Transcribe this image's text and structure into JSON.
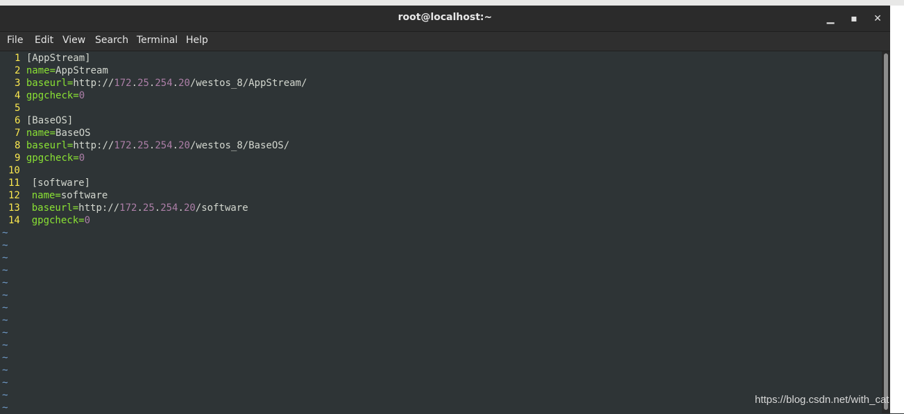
{
  "window": {
    "title": "root@localhost:~",
    "minimize_glyph": "▁",
    "maximize_glyph": "▪",
    "close_glyph": "✕"
  },
  "menu": [
    "File",
    "Edit",
    "View",
    "Search",
    "Terminal",
    "Help"
  ],
  "editor": {
    "lines": [
      {
        "n": "1",
        "parts": [
          {
            "t": "[AppStream]",
            "c": "txt"
          }
        ]
      },
      {
        "n": "2",
        "parts": [
          {
            "t": "name=",
            "c": "kw"
          },
          {
            "t": "AppStream",
            "c": "txt"
          }
        ]
      },
      {
        "n": "3",
        "parts": [
          {
            "t": "baseurl=",
            "c": "kw"
          },
          {
            "t": "http://",
            "c": "txt"
          },
          {
            "t": "172",
            "c": "num"
          },
          {
            "t": ".",
            "c": "txt"
          },
          {
            "t": "25",
            "c": "num"
          },
          {
            "t": ".",
            "c": "txt"
          },
          {
            "t": "254",
            "c": "num"
          },
          {
            "t": ".",
            "c": "txt"
          },
          {
            "t": "20",
            "c": "num"
          },
          {
            "t": "/westos_8/AppStream/",
            "c": "txt"
          }
        ]
      },
      {
        "n": "4",
        "parts": [
          {
            "t": "gpgcheck=",
            "c": "kw"
          },
          {
            "t": "0",
            "c": "num"
          }
        ]
      },
      {
        "n": "5",
        "parts": []
      },
      {
        "n": "6",
        "parts": [
          {
            "t": "[BaseOS]",
            "c": "txt"
          }
        ]
      },
      {
        "n": "7",
        "parts": [
          {
            "t": "name=",
            "c": "kw"
          },
          {
            "t": "BaseOS",
            "c": "txt"
          }
        ]
      },
      {
        "n": "8",
        "parts": [
          {
            "t": "baseurl=",
            "c": "kw"
          },
          {
            "t": "http://",
            "c": "txt"
          },
          {
            "t": "172",
            "c": "num"
          },
          {
            "t": ".",
            "c": "txt"
          },
          {
            "t": "25",
            "c": "num"
          },
          {
            "t": ".",
            "c": "txt"
          },
          {
            "t": "254",
            "c": "num"
          },
          {
            "t": ".",
            "c": "txt"
          },
          {
            "t": "20",
            "c": "num"
          },
          {
            "t": "/westos_8/BaseOS/",
            "c": "txt"
          }
        ]
      },
      {
        "n": "9",
        "parts": [
          {
            "t": "gpgcheck=",
            "c": "kw"
          },
          {
            "t": "0",
            "c": "num"
          }
        ]
      },
      {
        "n": "10",
        "parts": []
      },
      {
        "n": "11",
        "parts": [
          {
            "t": "[software]",
            "c": "txt"
          }
        ]
      },
      {
        "n": "12",
        "parts": [
          {
            "t": "name=",
            "c": "kw"
          },
          {
            "t": "software",
            "c": "txt"
          }
        ]
      },
      {
        "n": "13",
        "parts": [
          {
            "t": "baseurl=",
            "c": "kw"
          },
          {
            "t": "http://",
            "c": "txt"
          },
          {
            "t": "172",
            "c": "num"
          },
          {
            "t": ".",
            "c": "txt"
          },
          {
            "t": "25",
            "c": "num"
          },
          {
            "t": ".",
            "c": "txt"
          },
          {
            "t": "254",
            "c": "num"
          },
          {
            "t": ".",
            "c": "txt"
          },
          {
            "t": "20",
            "c": "num"
          },
          {
            "t": "/software",
            "c": "txt"
          }
        ]
      },
      {
        "n": "14",
        "parts": [
          {
            "t": "gpgcheck=",
            "c": "kw"
          },
          {
            "t": "0",
            "c": "num"
          }
        ]
      }
    ],
    "tilde_glyph": "~",
    "tilde_count": 15
  },
  "watermark": "https://blog.csdn.net/with_cat",
  "colors": {
    "background": "#2e3436",
    "line_number": "#fce94f",
    "keyword": "#8ae234",
    "number": "#ad7fa8",
    "tilde": "#729fcf"
  }
}
